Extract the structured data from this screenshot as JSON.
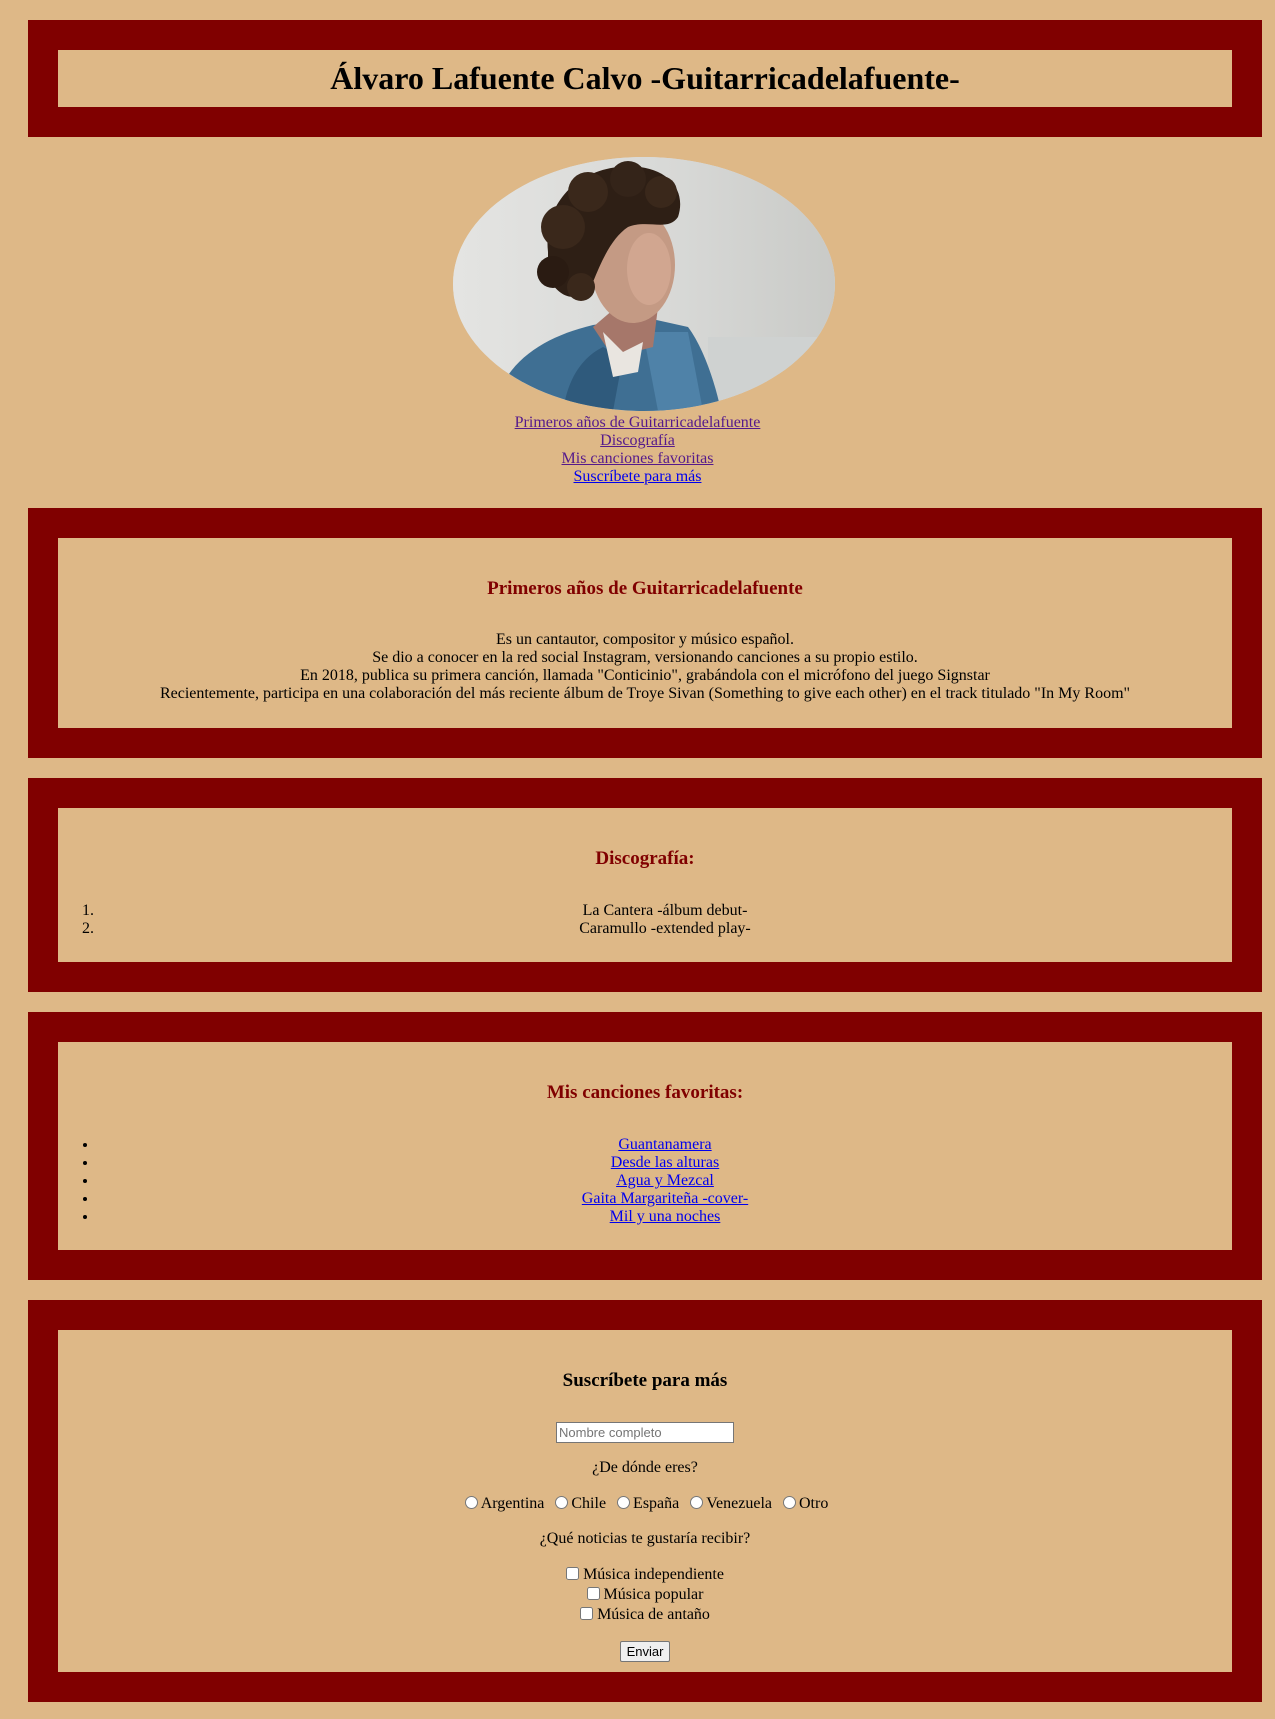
{
  "header": {
    "title": "Álvaro Lafuente Calvo -Guitarricadelafuente-"
  },
  "nav": {
    "items": [
      "Primeros años de Guitarricadelafuente",
      "Discografía",
      "Mis canciones favoritas",
      "Suscríbete para más"
    ]
  },
  "about": {
    "title": "Primeros años de Guitarricadelafuente",
    "lines": [
      "Es un cantautor, compositor y músico español.",
      "Se dio a conocer en la red social Instagram, versionando canciones a su propio estilo.",
      "En 2018, publica su primera canción, llamada \"Conticinio\", grabándola con el micrófono del juego Signstar",
      "Recientemente, participa en una colaboración del más reciente álbum de Troye Sivan (Something to give each other) en el track titulado \"In My Room\""
    ]
  },
  "discography": {
    "title": "Discografía:",
    "items": [
      "La Cantera -álbum debut-",
      "Caramullo -extended play-"
    ]
  },
  "favorites": {
    "title": "Mis canciones favoritas:",
    "items": [
      "Guantanamera",
      "Desde las alturas",
      "Agua y Mezcal",
      "Gaita Margariteña -cover-",
      "Mil y una noches"
    ]
  },
  "subscribe": {
    "title": "Suscríbete para más",
    "name_placeholder": "Nombre completo",
    "country_question": "¿De dónde eres?",
    "countries": [
      "Argentina",
      "Chile",
      "España",
      "Venezuela",
      "Otro"
    ],
    "news_question": "¿Qué noticias te gustaría recibir?",
    "news_options": [
      "Música independiente",
      "Música popular",
      "Música de antaño"
    ],
    "submit_label": "Enviar"
  },
  "colors": {
    "background": "#deb887",
    "frame": "#800000",
    "section_title": "#800000",
    "visited_link": "#551a8b",
    "link": "#0000ee"
  }
}
